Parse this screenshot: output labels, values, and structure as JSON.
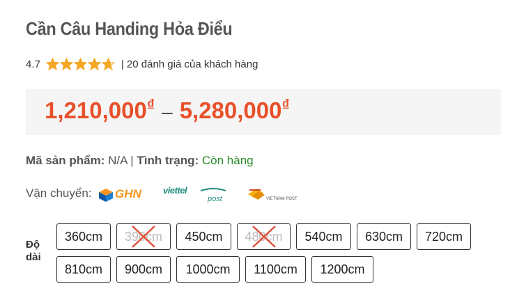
{
  "product": {
    "title": "Cần Câu Handing Hỏa Điểu",
    "rating": "4.7",
    "rating_value": 4.7,
    "rating_max": 5,
    "review_text": "| 20 đánh giá của khách hàng",
    "star_color": "#f5a623"
  },
  "price": {
    "min": "1,210,000",
    "max": "5,280,000",
    "currency": "₫",
    "separator": "–",
    "color": "#e8502a"
  },
  "info": {
    "sku_label": "Mã sản phẩm:",
    "sku_value": "N/A",
    "divider": "|",
    "status_label": "Tình trạng:",
    "status_value": "Còn hàng"
  },
  "shipping": {
    "label": "Vận chuyển:",
    "carriers": [
      {
        "icon": "ghn-logo",
        "name": "GHN"
      },
      {
        "icon": "viettel-post-logo",
        "name": "viettel post"
      },
      {
        "icon": "vietnam-post-logo",
        "name": "VIETNAM POST"
      }
    ]
  },
  "length": {
    "label": "Độ dài",
    "options": [
      {
        "value": "360cm",
        "available": true
      },
      {
        "value": "390cm",
        "available": false
      },
      {
        "value": "450cm",
        "available": true
      },
      {
        "value": "480cm",
        "available": false
      },
      {
        "value": "540cm",
        "available": true
      },
      {
        "value": "630cm",
        "available": true
      },
      {
        "value": "720cm",
        "available": true
      },
      {
        "value": "810cm",
        "available": true
      },
      {
        "value": "900cm",
        "available": true
      },
      {
        "value": "1000cm",
        "available": true
      },
      {
        "value": "1100cm",
        "available": true
      },
      {
        "value": "1200cm",
        "available": true
      }
    ]
  }
}
